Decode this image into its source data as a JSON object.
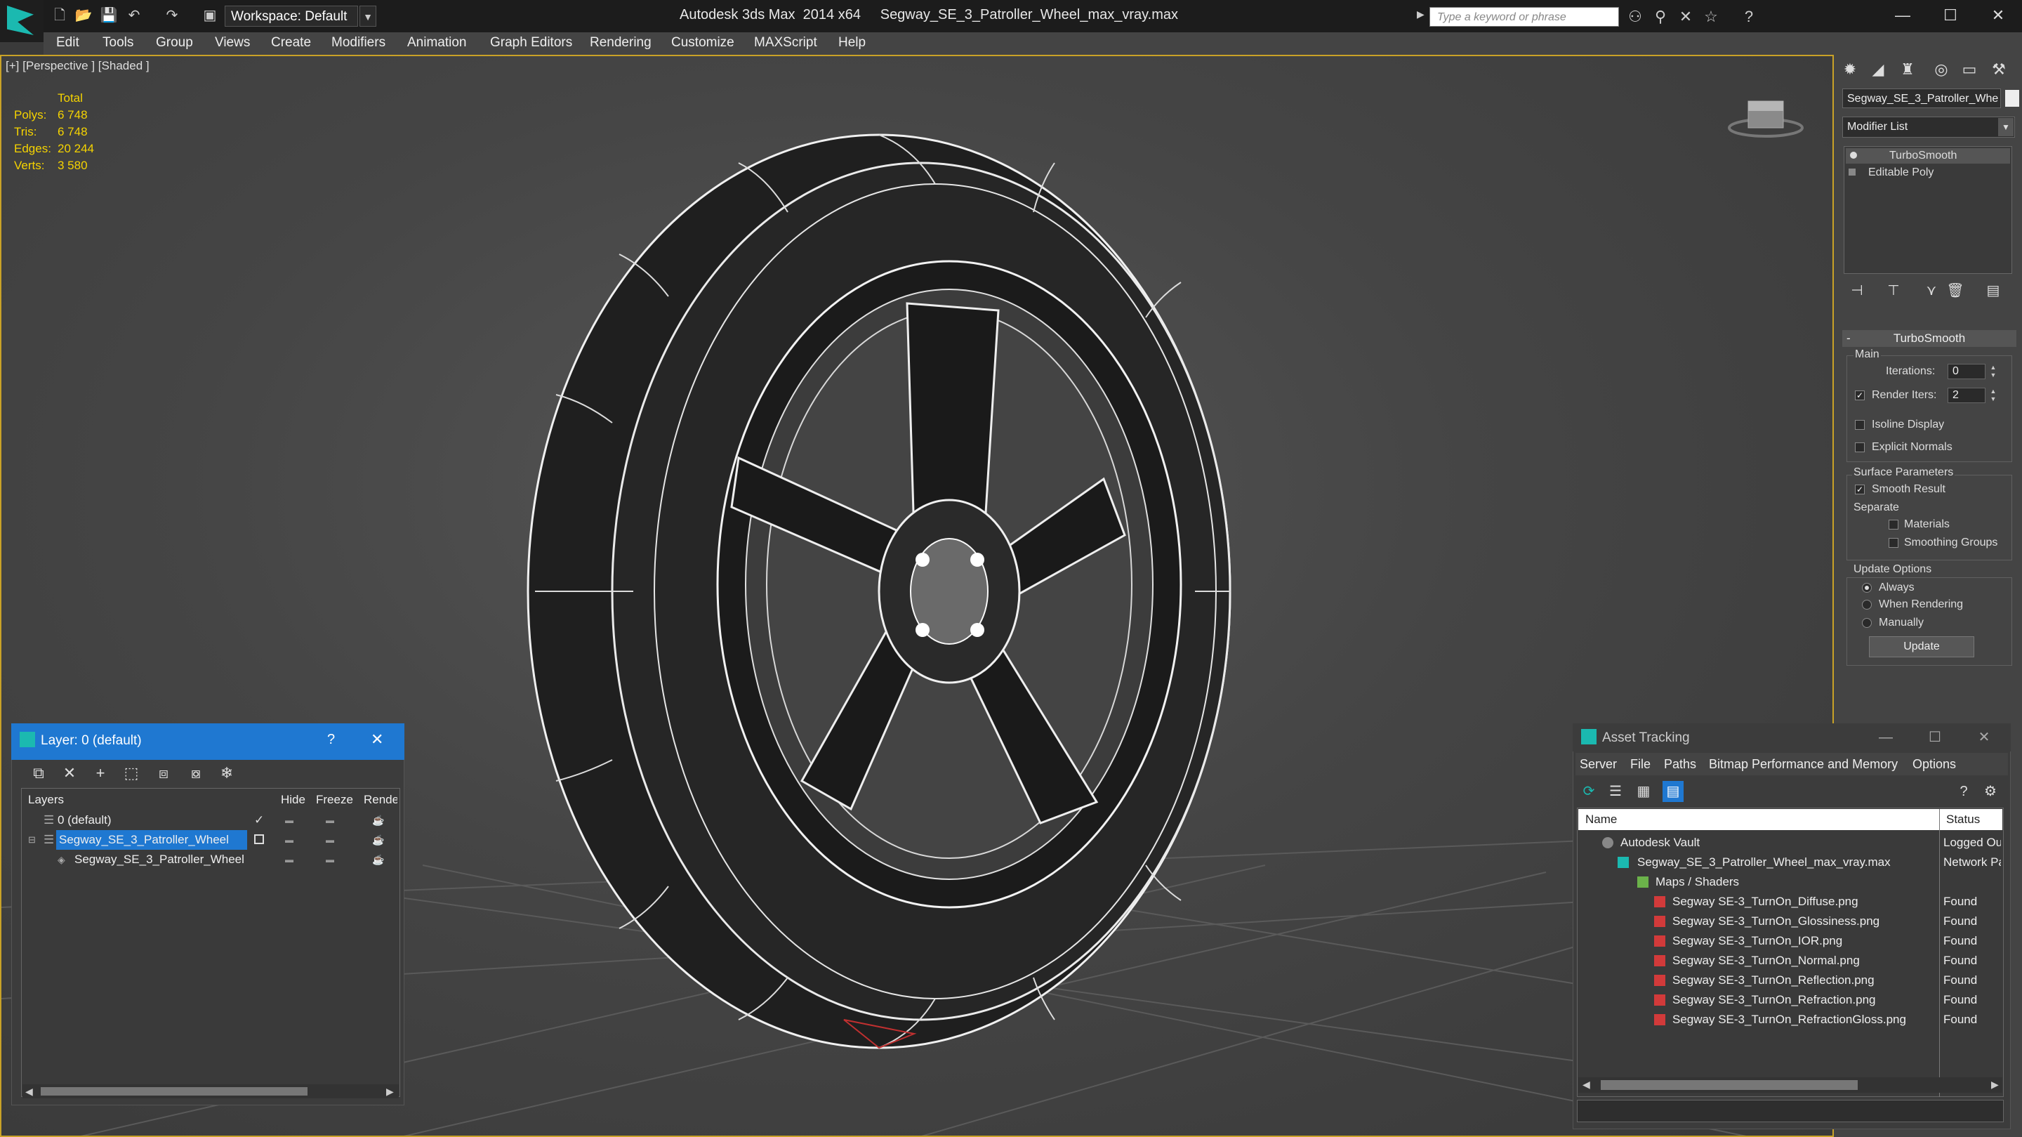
{
  "app": {
    "title": "Autodesk 3ds Max  2014 x64     Segway_SE_3_Patroller_Wheel_max_vray.max",
    "workspace": "Workspace: Default",
    "search_placeholder": "Type a keyword or phrase"
  },
  "menu": [
    "Edit",
    "Tools",
    "Group",
    "Views",
    "Create",
    "Modifiers",
    "Animation",
    "Graph Editors",
    "Rendering",
    "Customize",
    "MAXScript",
    "Help"
  ],
  "viewport": {
    "label": "[+] [Perspective ] [Shaded ]",
    "stats_header": "Total",
    "stats": [
      {
        "key": "Polys:",
        "value": "6 748"
      },
      {
        "key": "Tris:",
        "value": "6 748"
      },
      {
        "key": "Edges:",
        "value": "20 244"
      },
      {
        "key": "Verts:",
        "value": "3 580"
      }
    ]
  },
  "command_panel": {
    "object_name": "Segway_SE_3_Patroller_Whe",
    "object_color": "#eeeeee",
    "modifier_list": "Modifier List",
    "stack": [
      "TurboSmooth",
      "Editable Poly"
    ],
    "rollout_title": "TurboSmooth",
    "main_label": "Main",
    "iterations_label": "Iterations:",
    "iterations_value": "0",
    "render_iters_label": "Render Iters:",
    "render_iters_value": "2",
    "isoline_label": "Isoline Display",
    "explicit_normals_label": "Explicit Normals",
    "surface_params_label": "Surface Parameters",
    "smooth_result_label": "Smooth Result",
    "separate_label": "Separate",
    "materials_label": "Materials",
    "smoothing_groups_label": "Smoothing Groups",
    "update_options_label": "Update Options",
    "update_options": [
      "Always",
      "When Rendering",
      "Manually"
    ],
    "update_button": "Update"
  },
  "layer_window": {
    "title": "Layer: 0 (default)",
    "help": "?",
    "columns": [
      "Layers",
      "Hide",
      "Freeze",
      "Render"
    ],
    "rows": [
      {
        "name": "0 (default)"
      },
      {
        "name": "Segway_SE_3_Patroller_Wheel"
      },
      {
        "name": "Segway_SE_3_Patroller_Wheel"
      }
    ]
  },
  "asset_tracking": {
    "title": "Asset Tracking",
    "menu": [
      "Server",
      "File",
      "Paths",
      "Bitmap Performance and Memory",
      "Options"
    ],
    "columns": [
      "Name",
      "Status"
    ],
    "rows": [
      {
        "name": "Autodesk Vault",
        "status": "Logged Out"
      },
      {
        "name": "Segway_SE_3_Patroller_Wheel_max_vray.max",
        "status": "Network Path"
      },
      {
        "name": "Maps / Shaders",
        "status": ""
      },
      {
        "name": "Segway SE-3_TurnOn_Diffuse.png",
        "status": "Found"
      },
      {
        "name": "Segway SE-3_TurnOn_Glossiness.png",
        "status": "Found"
      },
      {
        "name": "Segway SE-3_TurnOn_IOR.png",
        "status": "Found"
      },
      {
        "name": "Segway SE-3_TurnOn_Normal.png",
        "status": "Found"
      },
      {
        "name": "Segway SE-3_TurnOn_Reflection.png",
        "status": "Found"
      },
      {
        "name": "Segway SE-3_TurnOn_Refraction.png",
        "status": "Found"
      },
      {
        "name": "Segway SE-3_TurnOn_RefractionGloss.png",
        "status": "Found"
      }
    ]
  },
  "colors": {
    "accent": "#1f78d1",
    "viewport_border": "#c9a227",
    "stats": "#f5d300"
  }
}
